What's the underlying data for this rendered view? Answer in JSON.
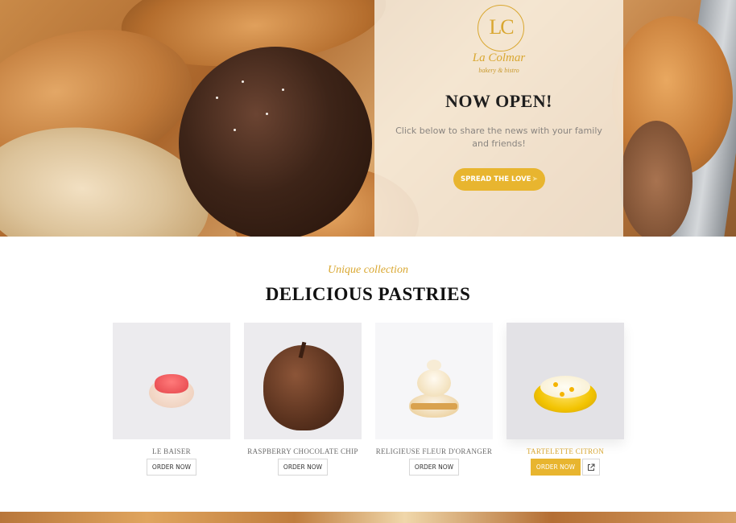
{
  "hero": {
    "logo_monogram": "LC",
    "logo_name": "La Colmar",
    "logo_tagline": "bakery & bistro",
    "title": "NOW OPEN!",
    "text": "Click below to share the news with your family and friends!",
    "button_label": "SPREAD THE LOVE",
    "button_icon": "paper-plane-icon"
  },
  "collection": {
    "kicker": "Unique collection",
    "title": "DELICIOUS PASTRIES",
    "products": [
      {
        "name": "LE BAISER",
        "order_label": "ORDER NOW"
      },
      {
        "name": "RASPBERRY CHOCOLATE CHIP",
        "order_label": "ORDER NOW"
      },
      {
        "name": "RELIGIEUSE FLEUR D'ORANGER",
        "order_label": "ORDER NOW"
      },
      {
        "name": "TARTELETTE CITRON",
        "order_label": "ORDER NOW",
        "external_link_icon": "external-link-icon"
      }
    ]
  },
  "colors": {
    "accent": "#e8b52f",
    "gold_text": "#d9a730",
    "title_text": "#111111"
  }
}
